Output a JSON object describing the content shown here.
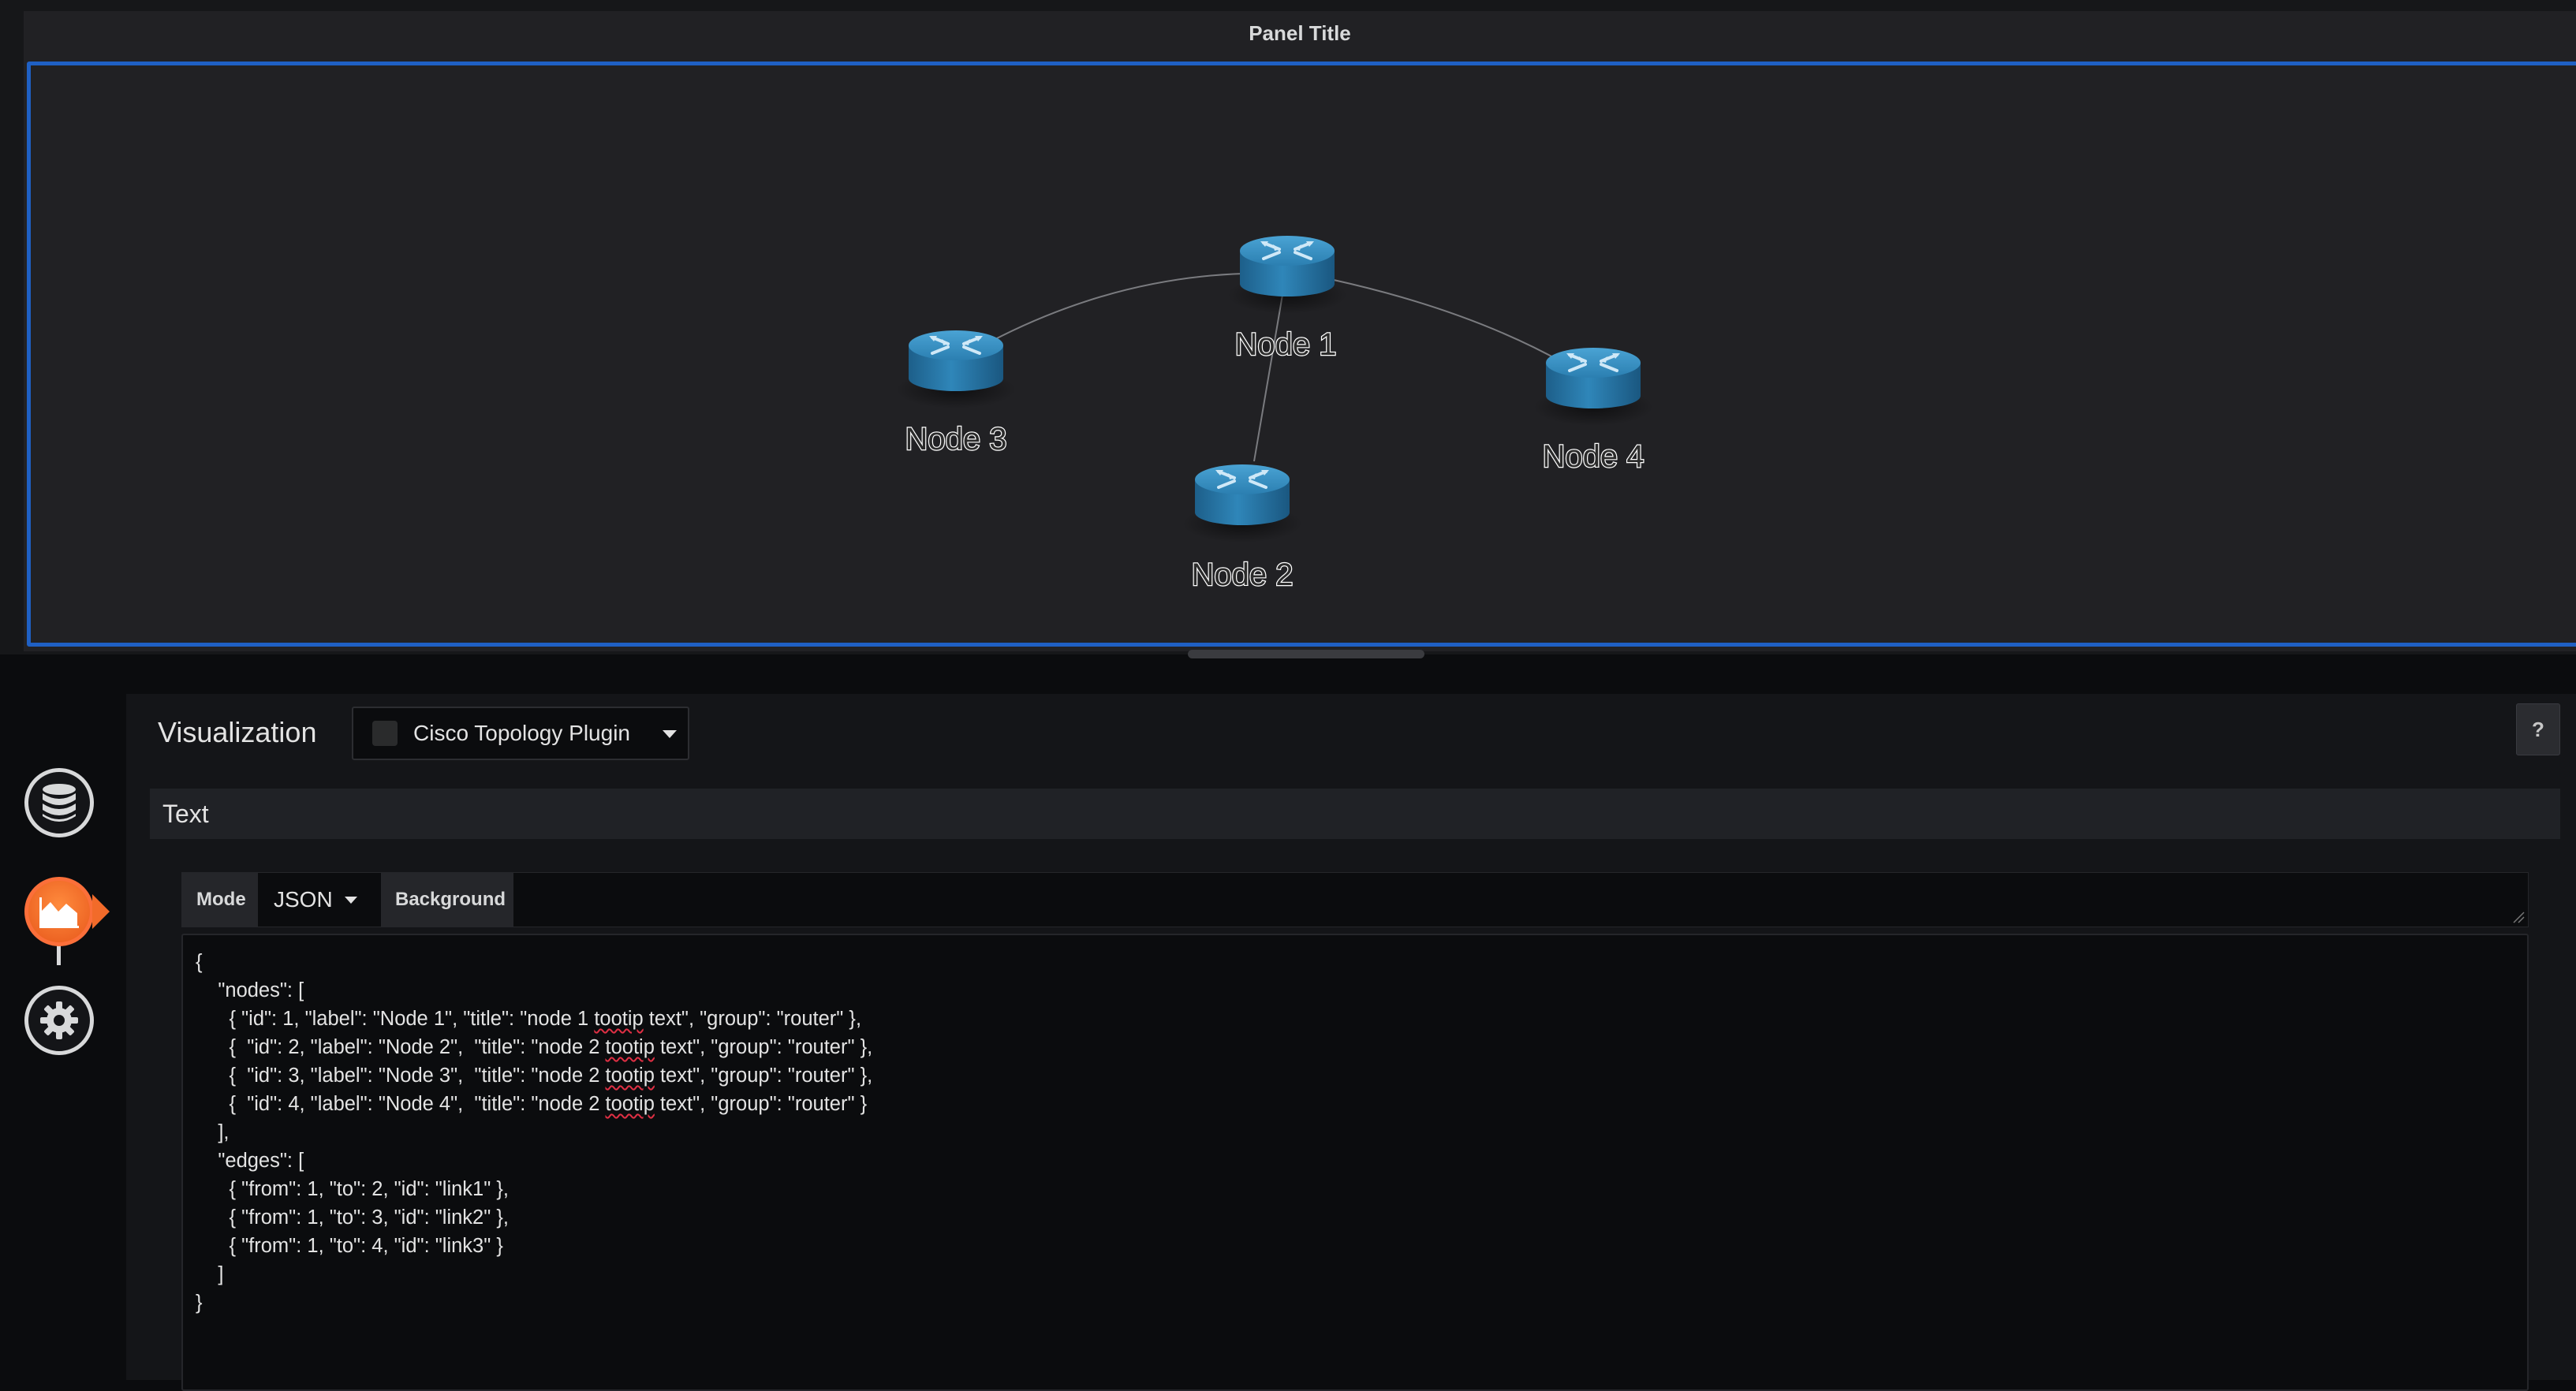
{
  "panel": {
    "title": "Panel Title"
  },
  "topology": {
    "nodes": [
      {
        "id": 1,
        "label": "Node 1",
        "icon": "router-icon"
      },
      {
        "id": 2,
        "label": "Node 2",
        "icon": "router-icon"
      },
      {
        "id": 3,
        "label": "Node 3",
        "icon": "router-icon"
      },
      {
        "id": 4,
        "label": "Node 4",
        "icon": "router-icon"
      }
    ],
    "edges": [
      {
        "from": 1,
        "to": 2,
        "id": "link1"
      },
      {
        "from": 1,
        "to": 3,
        "id": "link2"
      },
      {
        "from": 1,
        "to": 4,
        "id": "link3"
      }
    ]
  },
  "sidebar": {
    "items": [
      {
        "name": "queries",
        "icon": "database-icon",
        "active": false
      },
      {
        "name": "visualization",
        "icon": "area-chart-icon",
        "active": true
      },
      {
        "name": "general",
        "icon": "settings-icon",
        "active": false
      }
    ]
  },
  "editor": {
    "visualization_label": "Visualization",
    "plugin_name": "Cisco Topology Plugin",
    "help_label": "?",
    "section_title": "Text",
    "mode_label": "Mode",
    "mode_value": "JSON",
    "background_label": "Background",
    "background_value": "",
    "json_lines": [
      "{",
      "    \"nodes\": [",
      "      { \"id\": 1, \"label\": \"Node 1\", \"title\": \"node 1 tootip text\", \"group\": \"router\" },",
      "      {  \"id\": 2, \"label\": \"Node 2\",  \"title\": \"node 2 tootip text\", \"group\": \"router\" },",
      "      {  \"id\": 3, \"label\": \"Node 3\",  \"title\": \"node 2 tootip text\", \"group\": \"router\" },",
      "      {  \"id\": 4, \"label\": \"Node 4\",  \"title\": \"node 2 tootip text\", \"group\": \"router\" }",
      "    ],",
      "    \"edges\": [",
      "      { \"from\": 1, \"to\": 2, \"id\": \"link1\" },",
      "      { \"from\": 1, \"to\": 3, \"id\": \"link2\" },",
      "      { \"from\": 1, \"to\": 4, \"id\": \"link3\" }",
      "    ]",
      "}"
    ]
  },
  "colors": {
    "panel_border": "#1f60c4",
    "active_nav": "#f26b2a",
    "router_body": "#2a78a8"
  }
}
